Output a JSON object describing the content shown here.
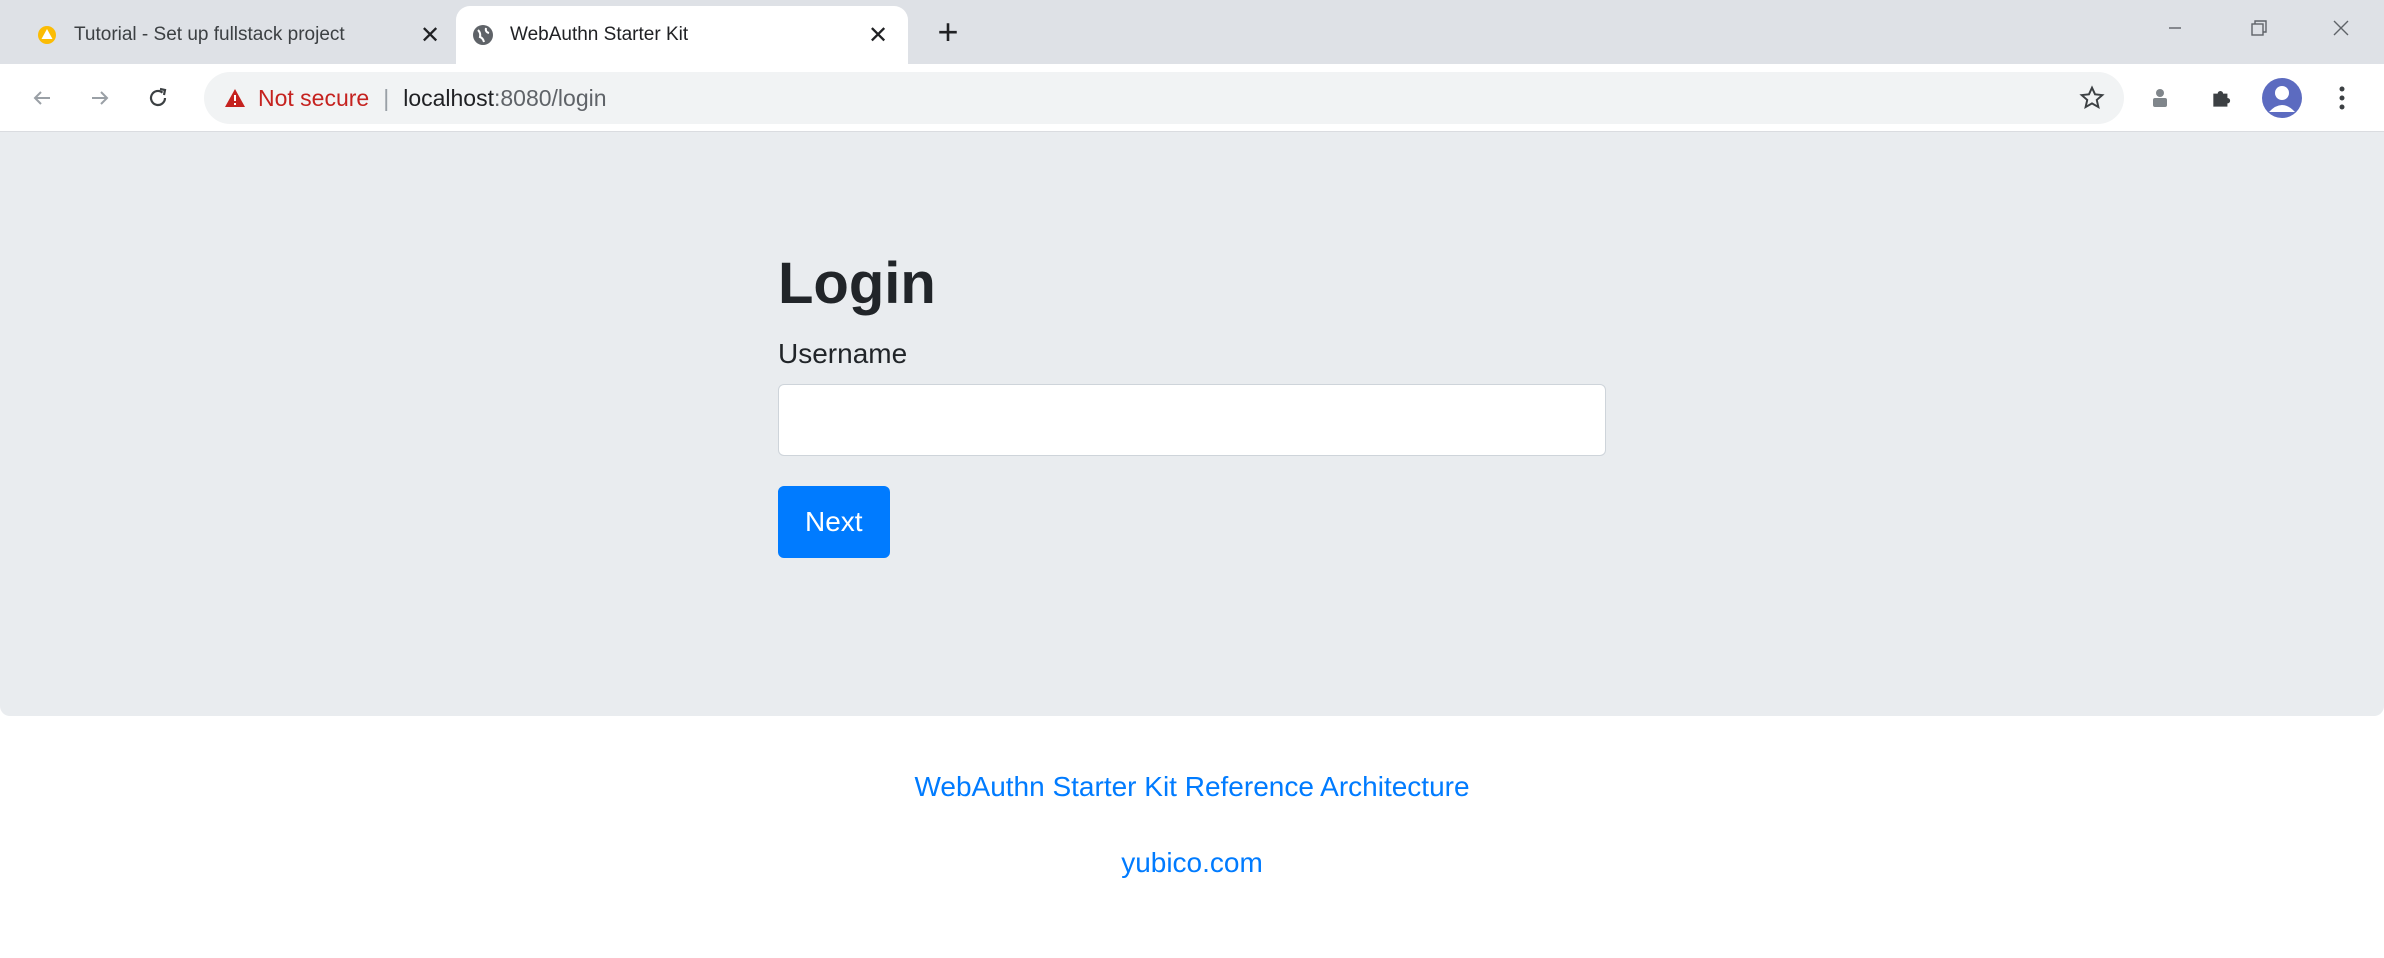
{
  "browser": {
    "tabs": [
      {
        "title": "Tutorial - Set up fullstack project",
        "favicon": "warning-triangle-icon",
        "active": false
      },
      {
        "title": "WebAuthn Starter Kit",
        "favicon": "globe-icon",
        "active": true
      }
    ],
    "new_tab_label": "+",
    "address": {
      "security_label": "Not secure",
      "separator": "|",
      "host": "localhost",
      "path": ":8080/login"
    }
  },
  "page": {
    "title": "Login",
    "username_label": "Username",
    "username_value": "",
    "username_placeholder": "",
    "next_label": "Next"
  },
  "footer": {
    "links": [
      {
        "label": "WebAuthn Starter Kit Reference Architecture"
      },
      {
        "label": "yubico.com"
      }
    ]
  },
  "colors": {
    "primary": "#007bff",
    "jumbotron": "#e9ecef",
    "warning": "#c5221f",
    "tabstrip": "#dee1e6"
  }
}
